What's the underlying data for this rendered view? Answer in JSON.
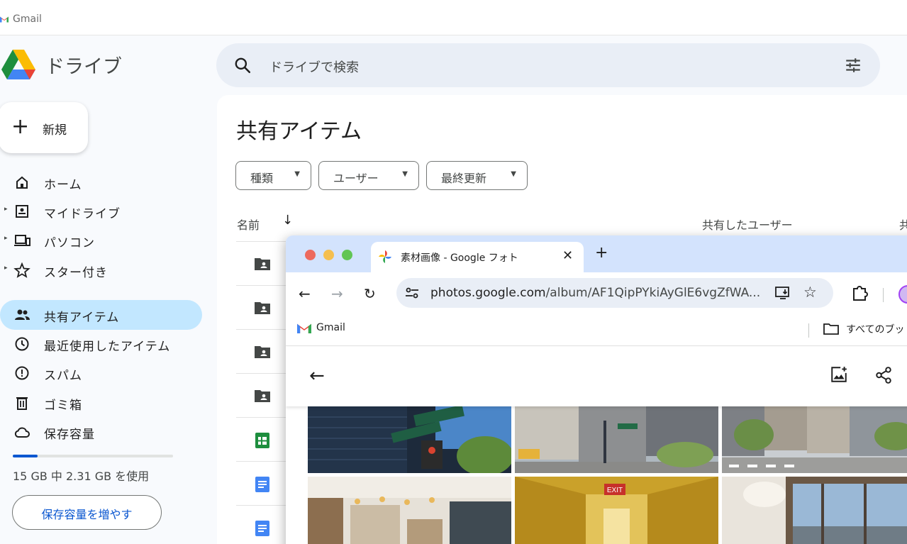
{
  "browser_tab": {
    "label": "Gmail"
  },
  "drive": {
    "app_title": "ドライブ",
    "search_placeholder": "ドライブで検索",
    "new_button": "新規",
    "nav": [
      {
        "label": "ホーム",
        "icon": "home-icon"
      },
      {
        "label": "マイドライブ",
        "icon": "my-drive-icon"
      },
      {
        "label": "パソコン",
        "icon": "computers-icon"
      },
      {
        "label": "スター付き",
        "icon": "star-icon"
      },
      {
        "label": "共有アイテム",
        "icon": "shared-people-icon",
        "active": true
      },
      {
        "label": "最近使用したアイテム",
        "icon": "clock-icon"
      },
      {
        "label": "スパム",
        "icon": "spam-icon"
      },
      {
        "label": "ゴミ箱",
        "icon": "trash-icon"
      },
      {
        "label": "保存容量",
        "icon": "cloud-icon"
      }
    ],
    "storage": {
      "used_fraction": 0.154,
      "text": "15 GB 中 2.31 GB を使用",
      "button": "保存容量を増やす"
    },
    "page_title": "共有アイテム",
    "filters": [
      "種類",
      "ユーザー",
      "最終更新"
    ],
    "columns": {
      "name": "名前",
      "shared_by": "共有したユーザー",
      "cut": "共"
    },
    "rows": [
      {
        "icon": "shared-folder-icon"
      },
      {
        "icon": "shared-folder-icon"
      },
      {
        "icon": "shared-folder-icon"
      },
      {
        "icon": "shared-folder-icon"
      },
      {
        "icon": "sheets-icon"
      },
      {
        "icon": "docs-icon"
      },
      {
        "icon": "docs-icon"
      }
    ]
  },
  "chrome": {
    "tab_title": "素材画像 - Google フォト",
    "url_domain": "photos.google.com",
    "url_path": "/album/AF1QipPYkiAyGlE6vgZfWA...",
    "bookmark_gmail": "Gmail",
    "bookmark_all": "すべてのブッ",
    "colors": {
      "close": "#ed6a5e",
      "minimize": "#f5bf4f",
      "maximize": "#61c554"
    }
  },
  "photos": [
    {
      "name": "photo-street-sign"
    },
    {
      "name": "photo-city-crossing"
    },
    {
      "name": "photo-avenue"
    },
    {
      "name": "photo-cafe-interior"
    },
    {
      "name": "photo-hotel-hallway"
    },
    {
      "name": "photo-window-view"
    }
  ]
}
